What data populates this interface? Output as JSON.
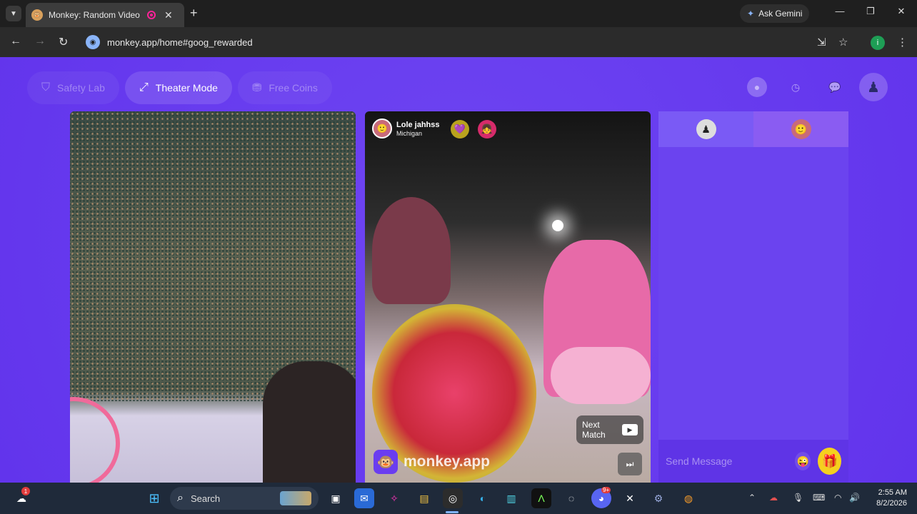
{
  "browser": {
    "tab_title": "Monkey: Random Video Ch",
    "new_tab": "+",
    "ask_gemini": "Ask Gemini",
    "url": "monkey.app/home#goog_rewarded",
    "profile_initial": "i"
  },
  "nav": {
    "safety_lab": "Safety Lab",
    "theater_mode": "Theater Mode",
    "free_coins": "Free Coins"
  },
  "match": {
    "name": "Lole jahhss",
    "location": "Michigan",
    "next_match_label": "Next Match",
    "brand": "monkey.app"
  },
  "chat": {
    "placeholder": "Send Message"
  },
  "taskbar": {
    "search_label": "Search",
    "notification_count": "1",
    "discord_badge": "9+",
    "time": "2:55 AM",
    "date": "8/2/2026"
  },
  "colors": {
    "page_bg": "#6a3df0",
    "gift_button": "#f5d01e",
    "chrome_dark": "#1f1f1f"
  }
}
